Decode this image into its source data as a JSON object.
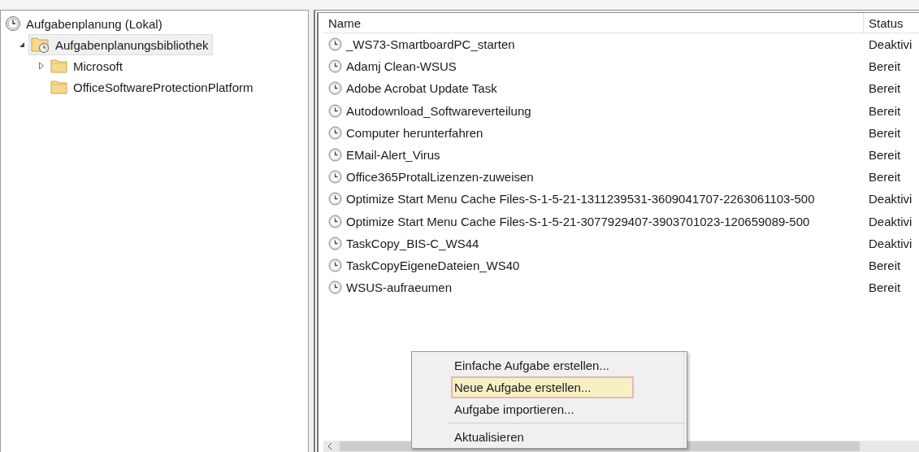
{
  "tree": [
    {
      "kind": "root",
      "label": "Aufgabenplanung (Lokal)",
      "selected": false,
      "children": [
        {
          "kind": "library",
          "label": "Aufgabenplanungsbibliothek",
          "expanded": true,
          "selected": true,
          "children": [
            {
              "kind": "folder",
              "label": "Microsoft",
              "expanded": false,
              "selected": false
            },
            {
              "kind": "folder",
              "label": "OfficeSoftwareProtectionPlatform",
              "selected": false
            }
          ]
        }
      ]
    }
  ],
  "table": {
    "columns": [
      "Name",
      "Status"
    ],
    "rows": [
      {
        "name": "_WS73-SmartboardPC_starten",
        "status": "Deaktivi"
      },
      {
        "name": "Adamj Clean-WSUS",
        "status": "Bereit"
      },
      {
        "name": "Adobe Acrobat Update Task",
        "status": "Bereit"
      },
      {
        "name": "Autodownload_Softwareverteilung",
        "status": "Bereit"
      },
      {
        "name": "Computer herunterfahren",
        "status": "Bereit"
      },
      {
        "name": "EMail-Alert_Virus",
        "status": "Bereit"
      },
      {
        "name": "Office365ProtalLizenzen-zuweisen",
        "status": "Bereit"
      },
      {
        "name": "Optimize Start Menu Cache Files-S-1-5-21-1311239531-3609041707-2263061103-500",
        "status": "Deaktivi"
      },
      {
        "name": "Optimize Start Menu Cache Files-S-1-5-21-3077929407-3903701023-120659089-500",
        "status": "Deaktivi"
      },
      {
        "name": "TaskCopy_BIS-C_WS44",
        "status": "Deaktivi"
      },
      {
        "name": "TaskCopyEigeneDateien_WS40",
        "status": "Bereit"
      },
      {
        "name": "WSUS-aufraeumen",
        "status": "Bereit"
      }
    ]
  },
  "context_menu": {
    "items": [
      {
        "kind": "command",
        "label": "Einfache Aufgabe erstellen...",
        "selected": false
      },
      {
        "kind": "command",
        "label": "Neue Aufgabe erstellen...",
        "selected": true
      },
      {
        "kind": "command",
        "label": "Aufgabe importieren...",
        "selected": false
      },
      {
        "kind": "separator"
      },
      {
        "kind": "command",
        "label": "Aktualisieren",
        "selected": false
      }
    ]
  }
}
